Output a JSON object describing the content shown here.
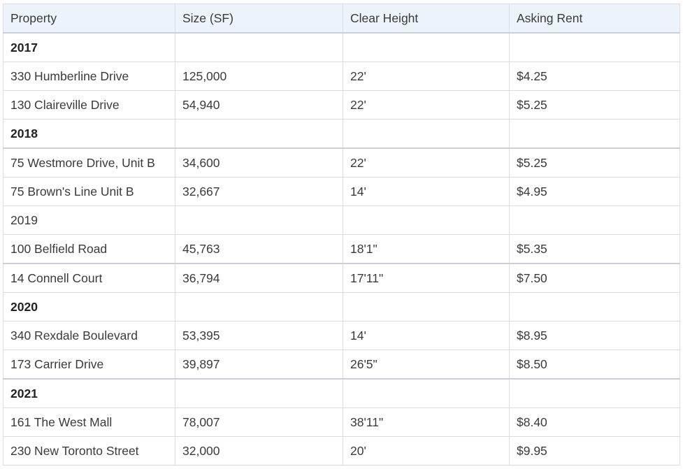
{
  "table": {
    "headers": [
      "Property",
      "Size (SF)",
      "Clear Height",
      "Asking Rent"
    ],
    "rows": [
      {
        "type": "year",
        "bold": true,
        "cells": [
          "2017",
          "",
          "",
          ""
        ]
      },
      {
        "type": "data",
        "cells": [
          "330 Humberline Drive",
          "125,000",
          "22'",
          "$4.25"
        ]
      },
      {
        "type": "data",
        "cells": [
          "130 Claireville Drive",
          "54,940",
          "22'",
          "$5.25"
        ]
      },
      {
        "type": "year",
        "bold": true,
        "cells": [
          "2018",
          "",
          "",
          ""
        ]
      },
      {
        "type": "data",
        "group_start": true,
        "cells": [
          "75 Westmore Drive, Unit B",
          "34,600",
          "22'",
          "$5.25"
        ]
      },
      {
        "type": "data",
        "cells": [
          "75 Brown's Line Unit B",
          "32,667",
          "14'",
          "$4.95"
        ]
      },
      {
        "type": "year",
        "bold": false,
        "cells": [
          "2019",
          "",
          "",
          ""
        ]
      },
      {
        "type": "data",
        "cells": [
          "100 Belfield Road",
          "45,763",
          "18'1\"",
          "$5.35"
        ]
      },
      {
        "type": "data",
        "group_start": true,
        "cells": [
          "14 Connell Court",
          "36,794",
          "17'11\"",
          "$7.50"
        ]
      },
      {
        "type": "year",
        "bold": true,
        "cells": [
          "2020",
          "",
          "",
          ""
        ]
      },
      {
        "type": "data",
        "cells": [
          "340 Rexdale Boulevard",
          "53,395",
          "14'",
          "$8.95"
        ]
      },
      {
        "type": "data",
        "cells": [
          "173 Carrier Drive",
          "39,897",
          "26'5\"",
          "$8.50"
        ]
      },
      {
        "type": "year",
        "bold": true,
        "group_start": true,
        "cells": [
          "2021",
          "",
          "",
          ""
        ]
      },
      {
        "type": "data",
        "cells": [
          "161 The West Mall",
          "78,007",
          "38'11\"",
          "$8.40"
        ]
      },
      {
        "type": "data",
        "cells": [
          "230 New Toronto Street",
          "32,000",
          "20'",
          "$9.95"
        ]
      }
    ]
  }
}
